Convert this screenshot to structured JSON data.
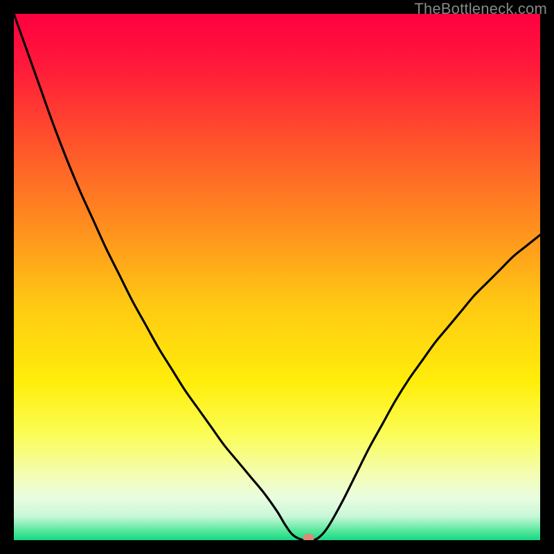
{
  "attribution": "TheBottleneck.com",
  "chart_data": {
    "type": "line",
    "title": "",
    "xlabel": "",
    "ylabel": "",
    "xlim": [
      0,
      100
    ],
    "ylim": [
      0,
      100
    ],
    "gradient_stops": [
      {
        "offset": 0.0,
        "color": "#ff0040"
      },
      {
        "offset": 0.1,
        "color": "#ff1a3a"
      },
      {
        "offset": 0.25,
        "color": "#ff552b"
      },
      {
        "offset": 0.4,
        "color": "#ff8d1f"
      },
      {
        "offset": 0.55,
        "color": "#ffc813"
      },
      {
        "offset": 0.7,
        "color": "#ffee0a"
      },
      {
        "offset": 0.8,
        "color": "#fbfd57"
      },
      {
        "offset": 0.88,
        "color": "#f3fdb8"
      },
      {
        "offset": 0.92,
        "color": "#e8fde0"
      },
      {
        "offset": 0.955,
        "color": "#c8f7d8"
      },
      {
        "offset": 0.98,
        "color": "#5fe9a0"
      },
      {
        "offset": 1.0,
        "color": "#17d885"
      }
    ],
    "series": [
      {
        "name": "bottleneck-curve",
        "x": [
          0.0,
          2.5,
          5.0,
          7.5,
          10.0,
          12.5,
          15.0,
          17.5,
          20.0,
          22.5,
          25.0,
          27.5,
          30.0,
          32.5,
          35.0,
          37.5,
          40.0,
          42.5,
          45.0,
          47.5,
          50.0,
          51.5,
          53.0,
          55.0,
          57.0,
          58.5,
          60.0,
          62.5,
          65.0,
          67.5,
          70.0,
          72.5,
          75.0,
          77.5,
          80.0,
          82.5,
          85.0,
          87.5,
          90.0,
          92.5,
          95.0,
          97.5,
          100.0
        ],
        "y": [
          100.0,
          93.0,
          86.0,
          79.0,
          72.5,
          66.5,
          61.0,
          55.5,
          50.5,
          45.5,
          41.0,
          36.5,
          32.5,
          28.5,
          25.0,
          21.5,
          18.0,
          15.0,
          12.0,
          9.0,
          5.5,
          3.0,
          1.0,
          0.0,
          0.0,
          1.0,
          3.0,
          7.5,
          12.5,
          17.5,
          22.0,
          26.5,
          30.5,
          34.0,
          37.5,
          40.5,
          43.5,
          46.5,
          49.0,
          51.5,
          54.0,
          56.0,
          58.0
        ]
      }
    ],
    "marker": {
      "x": 56.0,
      "y": 0.0,
      "color": "#d98b7a"
    }
  }
}
